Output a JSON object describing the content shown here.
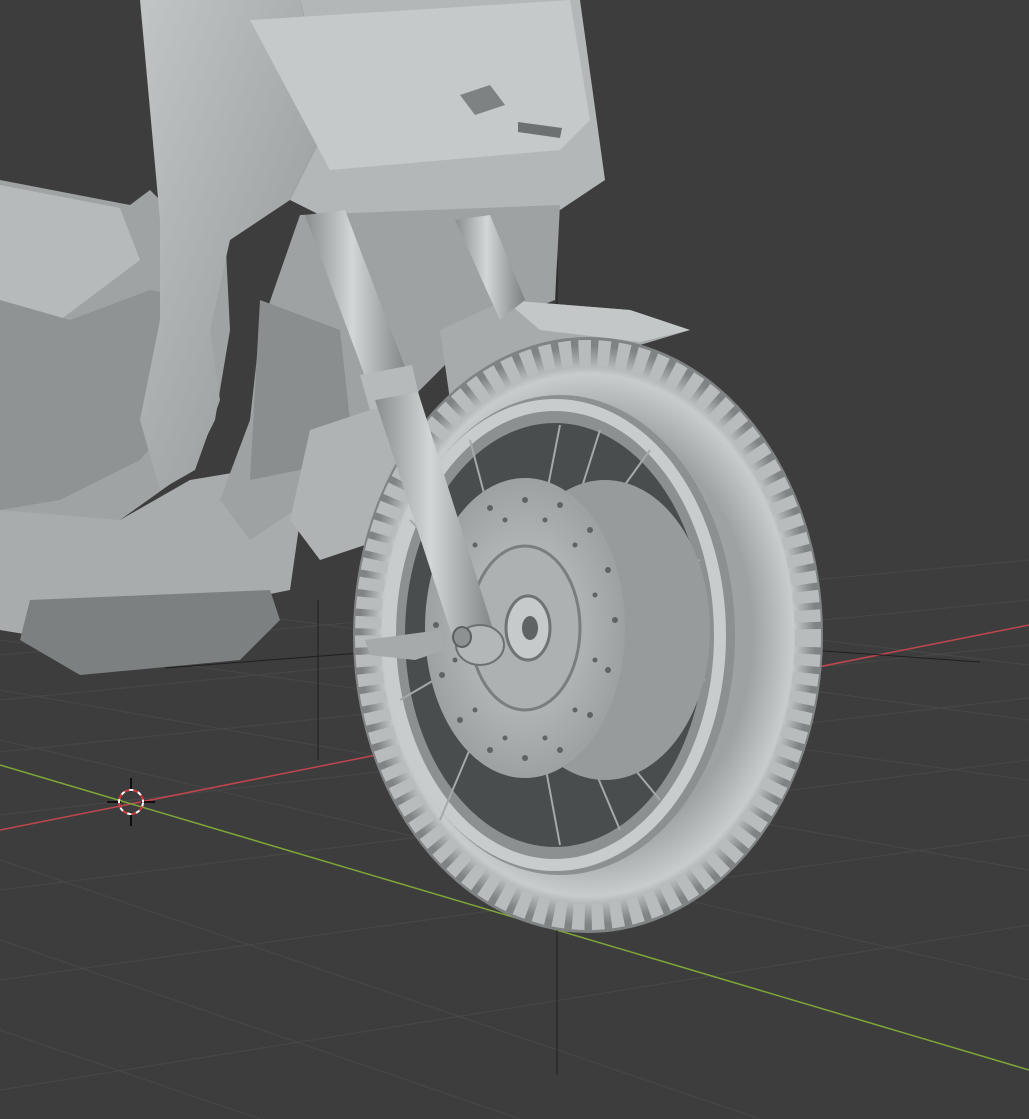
{
  "viewport": {
    "background_color": "#3d3d3d",
    "grid_line_color": "#474747",
    "x_axis_color": "#c0454f",
    "y_axis_color": "#7fa637",
    "model_base_color": "#a3a6a6",
    "model_shadow_color": "#6f7373",
    "model_highlight_color": "#d2d5d5"
  },
  "scene": {
    "object": "motorcycle-front",
    "shading": "solid",
    "icons": [
      "3d-cursor-icon"
    ]
  }
}
